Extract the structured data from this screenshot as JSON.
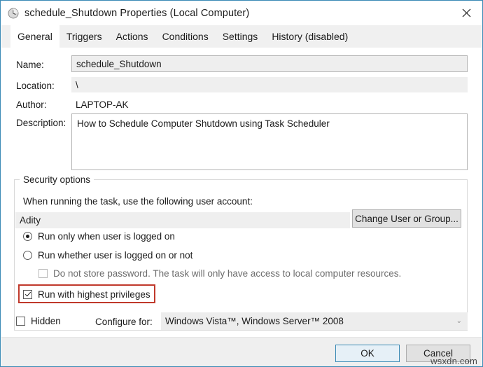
{
  "window": {
    "title": "schedule_Shutdown Properties (Local Computer)",
    "icon": "clock-icon",
    "close_label": "✕",
    "border_color": "#3a8ab5"
  },
  "tabs": [
    {
      "label": "General",
      "active": true
    },
    {
      "label": "Triggers",
      "active": false
    },
    {
      "label": "Actions",
      "active": false
    },
    {
      "label": "Conditions",
      "active": false
    },
    {
      "label": "Settings",
      "active": false
    },
    {
      "label": "History (disabled)",
      "active": false
    }
  ],
  "general": {
    "name_label": "Name:",
    "name_value": "schedule_Shutdown",
    "location_label": "Location:",
    "location_value": "\\",
    "author_label": "Author:",
    "author_value": "LAPTOP-AK",
    "description_label": "Description:",
    "description_value": "How to Schedule Computer Shutdown using Task Scheduler"
  },
  "security": {
    "legend": "Security options",
    "account_prompt": "When running the task, use the following user account:",
    "account_value": "Adity",
    "change_user_button": "Change User or Group...",
    "radio_logged_on": {
      "label": "Run only when user is logged on",
      "checked": true
    },
    "radio_whether_logged_on": {
      "label": "Run whether user is logged on or not",
      "checked": false
    },
    "checkbox_no_password": {
      "label": "Do not store password.  The task will only have access to local computer resources.",
      "checked": false,
      "enabled": false
    },
    "checkbox_highest_privileges": {
      "label": "Run with highest privileges",
      "checked": true,
      "highlight_color": "#c0392b"
    }
  },
  "bottom": {
    "hidden_label": "Hidden",
    "hidden_checked": false,
    "configure_for_label": "Configure for:",
    "configure_for_value": "Windows Vista™, Windows Server™ 2008",
    "chevron": "⌄"
  },
  "footer": {
    "ok_label": "OK",
    "cancel_label": "Cancel",
    "watermark": "wsxdn.com"
  }
}
